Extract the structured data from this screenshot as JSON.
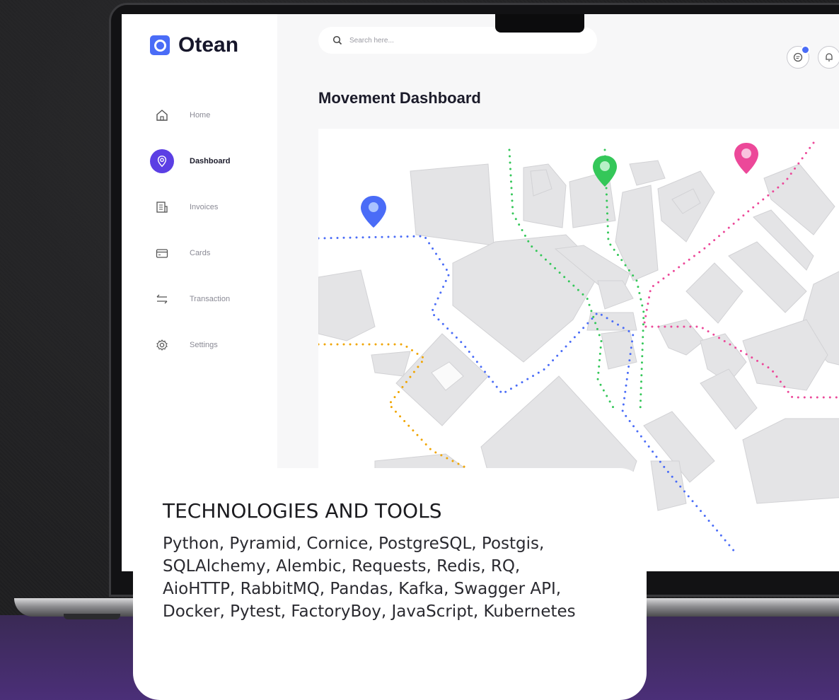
{
  "app": {
    "name": "Otean"
  },
  "search": {
    "placeholder": "Search here..."
  },
  "sidebar": {
    "items": [
      {
        "label": "Home",
        "icon": "home-icon",
        "active": false
      },
      {
        "label": "Dashboard",
        "icon": "location-icon",
        "active": true
      },
      {
        "label": "Invoices",
        "icon": "invoice-icon",
        "active": false
      },
      {
        "label": "Cards",
        "icon": "card-icon",
        "active": false
      },
      {
        "label": "Transaction",
        "icon": "transfer-icon",
        "active": false
      },
      {
        "label": "Settings",
        "icon": "gear-icon",
        "active": false
      }
    ]
  },
  "header": {
    "icons": [
      "message-icon",
      "bell-icon"
    ]
  },
  "main": {
    "title": "Movement Dashboard"
  },
  "colors": {
    "accent": "#5b3fe4",
    "logo": "#4a6cf7",
    "route_blue": "#4a6cf7",
    "route_green": "#34c759",
    "route_pink": "#ec4899",
    "route_orange": "#f0a500"
  },
  "info_card": {
    "title": "TECHNOLOGIES AND TOOLS",
    "body": "Python, Pyramid, Cornice, PostgreSQL, Postgis, SQLAlchemy, Alembic, Requests, Redis, RQ, AioHTTP, RabbitMQ, Pandas, Kafka, Swagger API, Docker, Pytest, FactoryBoy, JavaScript, Kubernetes"
  }
}
